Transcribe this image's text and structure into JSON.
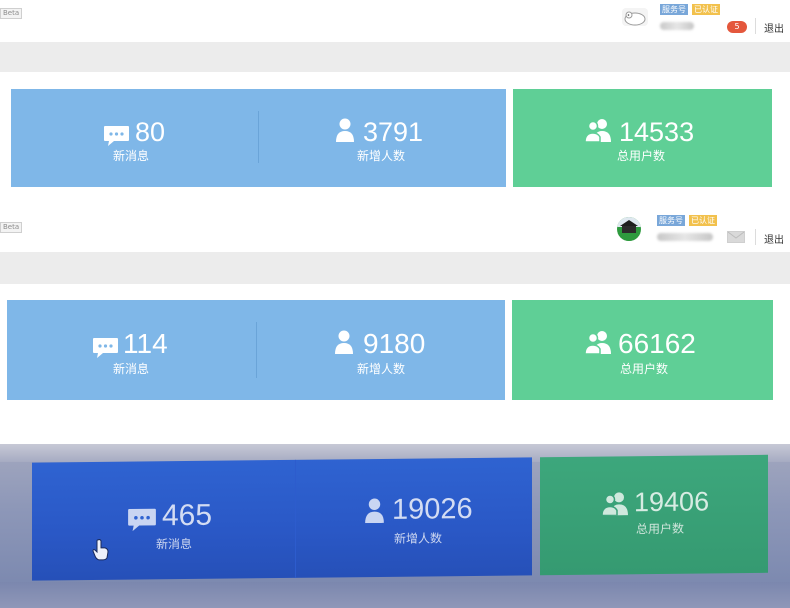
{
  "panels": [
    {
      "header": {
        "beta": "Beta",
        "service_tag": "服务号",
        "verified_tag": "已认证",
        "notification_count": "5",
        "logout": "退出"
      },
      "stats": [
        {
          "value": "80",
          "label": "新消息",
          "icon": "chat-bubble-icon"
        },
        {
          "value": "3791",
          "label": "新增人数",
          "icon": "person-icon"
        },
        {
          "value": "14533",
          "label": "总用户数",
          "icon": "users-icon"
        }
      ]
    },
    {
      "header": {
        "beta": "Beta",
        "service_tag": "服务号",
        "verified_tag": "已认证",
        "logout": "退出"
      },
      "stats": [
        {
          "value": "114",
          "label": "新消息",
          "icon": "chat-bubble-icon"
        },
        {
          "value": "9180",
          "label": "新增人数",
          "icon": "person-icon"
        },
        {
          "value": "66162",
          "label": "总用户数",
          "icon": "users-icon"
        }
      ]
    },
    {
      "stats": [
        {
          "value": "465",
          "label": "新消息",
          "icon": "chat-bubble-icon"
        },
        {
          "value": "19026",
          "label": "新增人数",
          "icon": "person-icon"
        },
        {
          "value": "19406",
          "label": "总用户数",
          "icon": "users-icon"
        }
      ]
    }
  ],
  "colors": {
    "stat_blue": "#7fb7e8",
    "stat_green": "#5fcf96",
    "photo_blue": "#2f5fcf",
    "photo_green": "#3aa079",
    "badge_red": "#e4573c"
  }
}
